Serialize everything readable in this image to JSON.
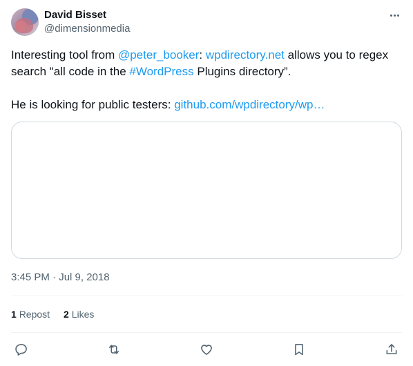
{
  "author": {
    "display_name": "David Bisset",
    "handle": "@dimensionmedia"
  },
  "tweet": {
    "line1_pre": "Interesting tool from ",
    "mention": "@peter_booker",
    "line1_colon": ": ",
    "link1": "wpdirectory.net",
    "line1_post": " allows you to regex search \"all code in the ",
    "hashtag": "#WordPress",
    "line1_end": " Plugins directory”.",
    "line2_pre": "He is looking for public testers: ",
    "link2": "github.com/wpdirectory/wp…"
  },
  "timestamp": "3:45 PM · Jul 9, 2018",
  "stats": {
    "reposts_count": "1",
    "reposts_label": "Repost",
    "likes_count": "2",
    "likes_label": "Likes"
  },
  "icons": [
    "more-icon",
    "reply-icon",
    "retweet-icon",
    "like-icon",
    "bookmark-icon",
    "share-icon"
  ],
  "colors": {
    "link": "#1d9bf0",
    "text": "#0f1419",
    "secondary": "#536471",
    "border": "#cfd9de"
  }
}
